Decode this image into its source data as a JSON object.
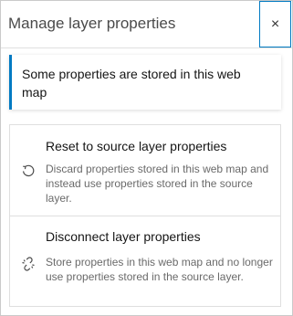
{
  "header": {
    "title": "Manage layer properties",
    "close_label": "×"
  },
  "notice": {
    "text": "Some properties are stored in this web map"
  },
  "actions": [
    {
      "title": "Reset to source layer properties",
      "description": "Discard properties stored in this web map and instead use properties stored in the source layer.",
      "icon": "reset-icon"
    },
    {
      "title": "Disconnect layer properties",
      "description": "Store properties in this web map and no longer use properties stored in the source layer.",
      "icon": "unlink-icon"
    }
  ],
  "colors": {
    "accent": "#007ac2",
    "text": "#151515",
    "muted": "#6a6a6a",
    "border": "#dfdfdf"
  }
}
